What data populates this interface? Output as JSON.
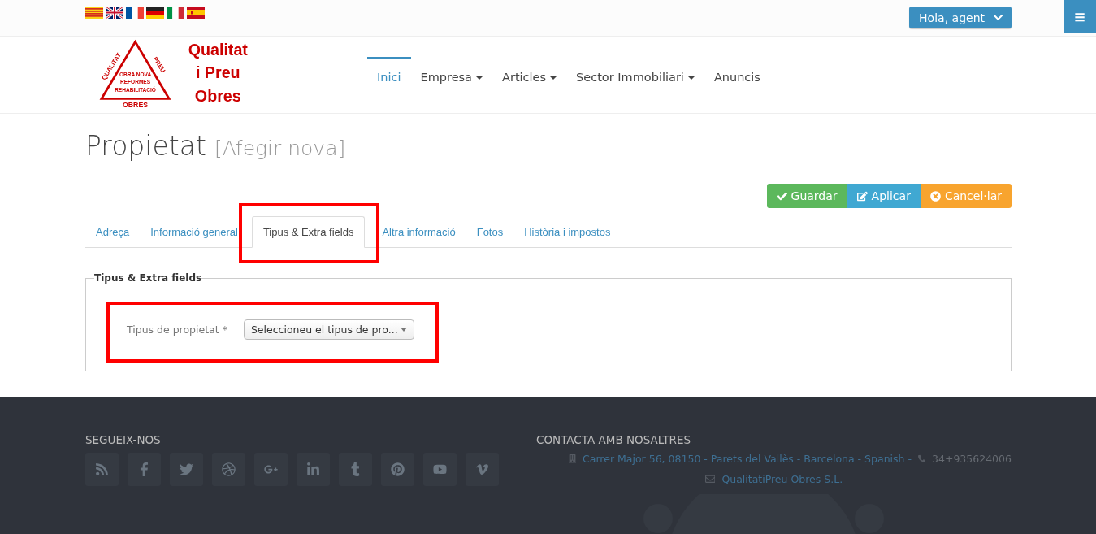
{
  "top_bar": {
    "user_menu": "Hola, agent",
    "menu_button": "≡"
  },
  "logo": {
    "ring_top_left": "QUALITAT",
    "ring_top_right": "PREU",
    "ring_bottom": "OBRES",
    "inner_lines": [
      "OBRA NOVA",
      "REFORMES",
      "REHABILITACIÓ"
    ],
    "name_lines": [
      "Qualitat",
      "i Preu",
      "Obres"
    ]
  },
  "nav": [
    {
      "label": "Inici",
      "selected": true,
      "dropdown": false
    },
    {
      "label": "Empresa",
      "selected": false,
      "dropdown": true
    },
    {
      "label": "Articles",
      "selected": false,
      "dropdown": true
    },
    {
      "label": "Sector Immobiliari",
      "selected": false,
      "dropdown": true
    },
    {
      "label": "Anuncis",
      "selected": false,
      "dropdown": false
    }
  ],
  "page_title": "Propietat",
  "page_subtitle": "[Afegir nova]",
  "actions": [
    {
      "kind": "save",
      "label": "Guardar"
    },
    {
      "kind": "apply",
      "label": "Aplicar"
    },
    {
      "kind": "cancel",
      "label": "Cancel·lar"
    }
  ],
  "tabs": [
    {
      "label": "Adreça",
      "selected": false
    },
    {
      "label": "Informació general",
      "selected": false
    },
    {
      "label": "Tipus & Extra fields",
      "selected": true
    },
    {
      "label": "Altra informació",
      "selected": false
    },
    {
      "label": "Fotos",
      "selected": false
    },
    {
      "label": "Història i impostos",
      "selected": false
    }
  ],
  "fieldset": {
    "legend": "Tipus & Extra fields",
    "field_label": "Tipus de propietat *",
    "select_value": "Seleccioneu el tipus de pro..."
  },
  "footer": {
    "follow_heading": "SEGUEIX-NOS",
    "social": [
      {
        "kind": "rss"
      },
      {
        "kind": "facebook"
      },
      {
        "kind": "twitter"
      },
      {
        "kind": "dribbble"
      },
      {
        "kind": "googleplus"
      },
      {
        "kind": "linkedin"
      },
      {
        "kind": "tumblr"
      },
      {
        "kind": "pinterest"
      },
      {
        "kind": "youtube"
      },
      {
        "kind": "vimeo"
      }
    ],
    "contact_heading": "CONTACTA AMB NOSALTRES",
    "address": "Carrer Major  56, 08150 - Parets del Vallès - Barcelona - Spanish -",
    "phone": "34+935624006",
    "email": "QualitatiPreu Obres S.L."
  }
}
